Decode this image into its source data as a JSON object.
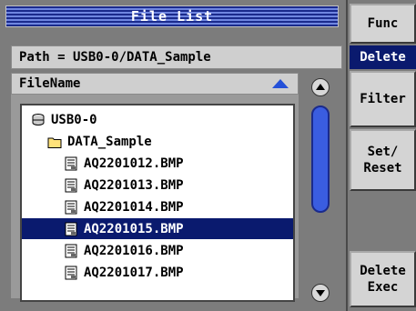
{
  "title": "File List",
  "path": "Path = USB0-0/DATA_Sample",
  "header": {
    "column": "FileName"
  },
  "tree": [
    {
      "label": "USB0-0",
      "icon": "drive-icon",
      "depth": 0,
      "selected": false
    },
    {
      "label": "DATA_Sample",
      "icon": "folder-icon",
      "depth": 1,
      "selected": false
    },
    {
      "label": "AQ2201012.BMP",
      "icon": "file-icon",
      "depth": 2,
      "selected": false
    },
    {
      "label": "AQ2201013.BMP",
      "icon": "file-icon",
      "depth": 2,
      "selected": false
    },
    {
      "label": "AQ2201014.BMP",
      "icon": "file-icon",
      "depth": 2,
      "selected": false
    },
    {
      "label": "AQ2201015.BMP",
      "icon": "file-icon",
      "depth": 2,
      "selected": true
    },
    {
      "label": "AQ2201016.BMP",
      "icon": "file-icon",
      "depth": 2,
      "selected": false
    },
    {
      "label": "AQ2201017.BMP",
      "icon": "file-icon",
      "depth": 2,
      "selected": false
    }
  ],
  "softkeys": {
    "func": "Func",
    "delete": "Delete",
    "filter": "Filter",
    "set_reset_1": "Set/",
    "set_reset_2": "Reset",
    "delete_exec_1": "Delete",
    "delete_exec_2": "Exec"
  },
  "colors": {
    "selection": "#0a1a6e",
    "accent": "#2450d8",
    "background": "#7c7c7c"
  }
}
